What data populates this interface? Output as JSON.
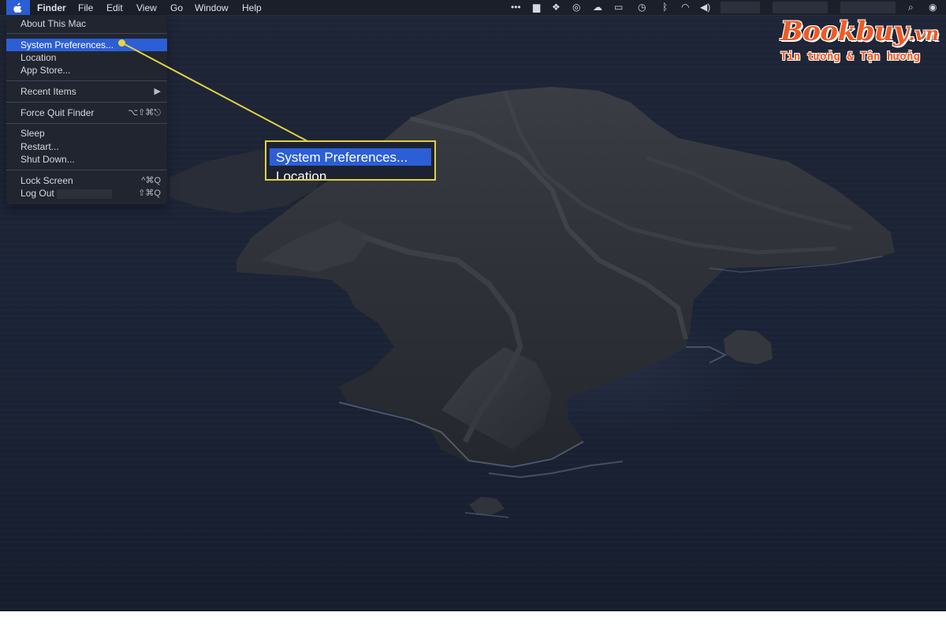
{
  "menubar": {
    "apple_icon": "apple-icon",
    "app_name": "Finder",
    "menus": [
      "File",
      "Edit",
      "View",
      "Go",
      "Window",
      "Help"
    ],
    "status_icons": [
      "more-icon",
      "notes-icon",
      "dropbox-icon",
      "creative-cloud-icon",
      "cloud-upload-icon",
      "airplay-icon",
      "time-machine-icon",
      "bluetooth-icon",
      "wifi-icon",
      "volume-icon",
      "search-icon",
      "siri-icon"
    ]
  },
  "apple_menu": {
    "items": [
      {
        "label": "About This Mac",
        "shortcut": ""
      },
      {
        "label": "System Preferences...",
        "shortcut": ""
      },
      {
        "label": "Location",
        "shortcut": ""
      },
      {
        "label": "App Store...",
        "shortcut": ""
      },
      {
        "label": "Recent Items",
        "shortcut": "▶"
      },
      {
        "label": "Force Quit Finder",
        "shortcut": "⌥⇧⌘⎋"
      },
      {
        "label": "Sleep",
        "shortcut": ""
      },
      {
        "label": "Restart...",
        "shortcut": ""
      },
      {
        "label": "Shut Down...",
        "shortcut": ""
      },
      {
        "label": "Lock Screen",
        "shortcut": "^⌘Q"
      },
      {
        "label": "Log Out",
        "shortcut": "⇧⌘Q"
      }
    ],
    "highlighted": "System Preferences..."
  },
  "callout": {
    "label": "System Preferences...",
    "partial_label": "Location",
    "accent": "#e0d145",
    "highlight": "#2c5fd6"
  },
  "watermark": {
    "brand": "Bookbuy",
    "brand_suffix": ".vn",
    "tagline": "Tin tưởng & Tận hưởng",
    "color": "#ef5a24"
  }
}
